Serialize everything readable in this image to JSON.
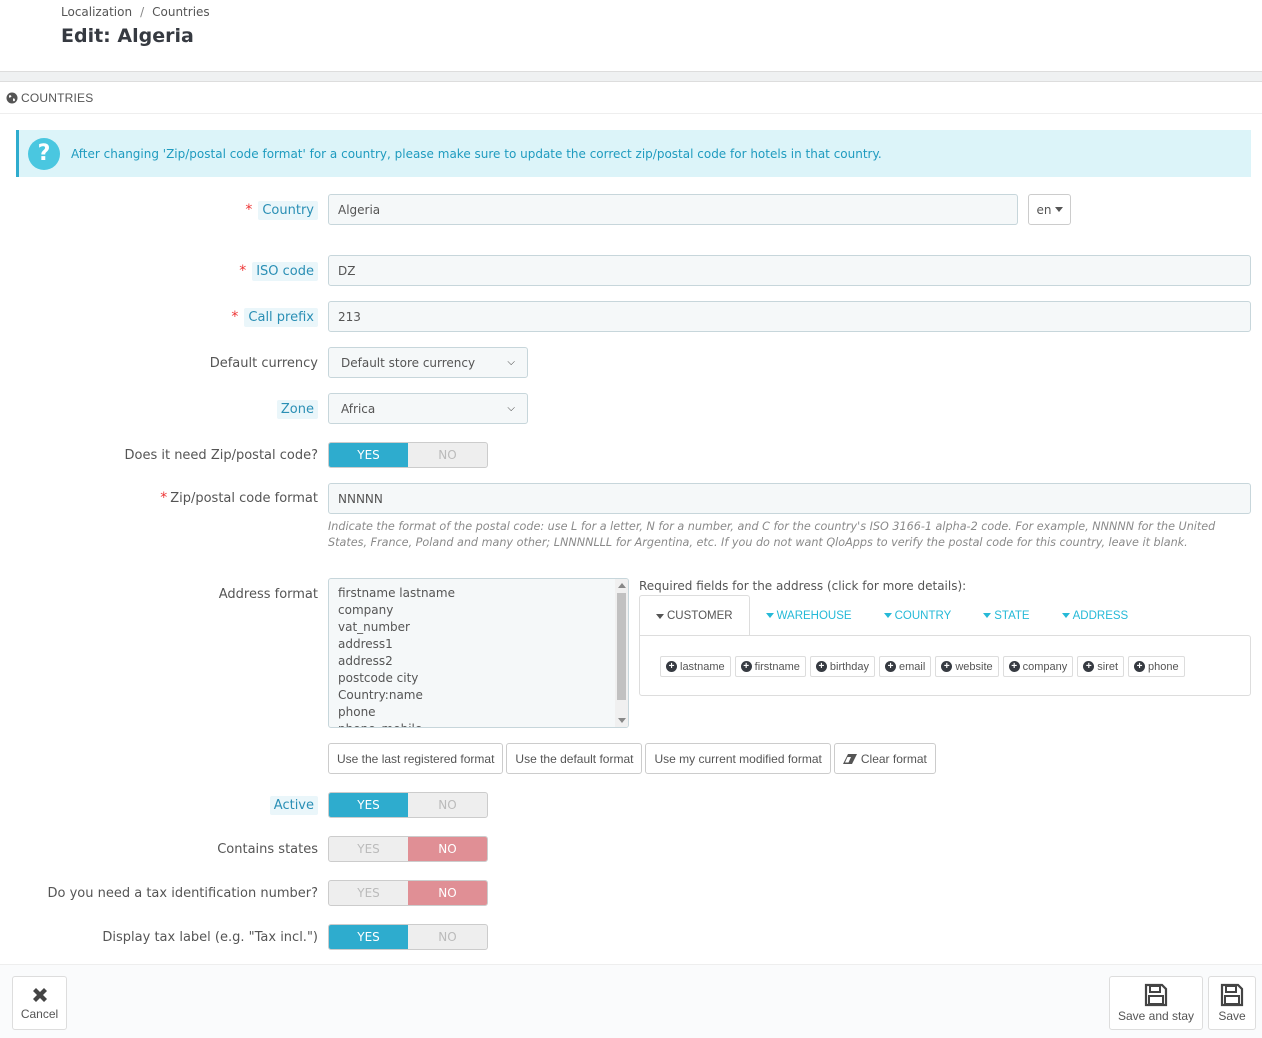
{
  "header": {
    "breadcrumb": [
      "Localization",
      "Countries"
    ],
    "breadcrumb_sep": "/",
    "title": "Edit: Algeria"
  },
  "panel": {
    "icon": "globe-icon",
    "title": "COUNTRIES"
  },
  "alert": {
    "icon": "question-circle-icon",
    "icon_glyph": "?",
    "text": "After changing 'Zip/postal code format' for a country, please make sure to update the correct zip/postal code for hotels in that country."
  },
  "form": {
    "country": {
      "label": "Country",
      "required": "*",
      "value": "Algeria",
      "lang": "en"
    },
    "iso_code": {
      "label": "ISO code",
      "required": "*",
      "value": "DZ"
    },
    "call_prefix": {
      "label": "Call prefix",
      "required": "*",
      "value": "213"
    },
    "default_currency": {
      "label": "Default currency",
      "selected": "Default store currency"
    },
    "zone": {
      "label": "Zone",
      "selected": "Africa"
    },
    "need_zip": {
      "label": "Does it need Zip/postal code?",
      "yes": "YES",
      "no": "NO",
      "value": "YES"
    },
    "zip_format": {
      "label": "Zip/postal code format",
      "required": "*",
      "value": "NNNNN",
      "help": "Indicate the format of the postal code: use L for a letter, N for a number, and C for the country's ISO 3166-1 alpha-2 code. For example, NNNNN for the United States, France, Poland and many other; LNNNNLLL for Argentina, etc. If you do not want QloApps to verify the postal code for this country, leave it blank."
    },
    "address_format": {
      "label": "Address format",
      "lines": [
        "firstname lastname",
        "company",
        "vat_number",
        "address1",
        "address2",
        "postcode city",
        "Country:name",
        "phone",
        "phone_mobile"
      ]
    },
    "required_fields": {
      "title": "Required fields for the address (click for more details):",
      "tabs": [
        "CUSTOMER",
        "WAREHOUSE",
        "COUNTRY",
        "STATE",
        "ADDRESS"
      ],
      "active_tab": "CUSTOMER",
      "fields": [
        "lastname",
        "firstname",
        "birthday",
        "email",
        "website",
        "company",
        "siret",
        "phone"
      ]
    },
    "format_buttons": {
      "last_registered": "Use the last registered format",
      "default": "Use the default format",
      "current_modified": "Use my current modified format",
      "clear": "Clear format"
    },
    "active": {
      "label": "Active",
      "yes": "YES",
      "no": "NO",
      "value": "YES"
    },
    "contains_states": {
      "label": "Contains states",
      "yes": "YES",
      "no": "NO",
      "value": "NO"
    },
    "need_tax_id": {
      "label": "Do you need a tax identification number?",
      "yes": "YES",
      "no": "NO",
      "value": "NO"
    },
    "display_tax_label": {
      "label": "Display tax label (e.g. \"Tax incl.\")",
      "yes": "YES",
      "no": "NO",
      "value": "YES"
    }
  },
  "footer": {
    "cancel": "Cancel",
    "save_and_stay": "Save and stay",
    "save": "Save"
  },
  "colors": {
    "accent": "#2eacce",
    "no_active": "#e08f95",
    "alert_bg": "#dcf4f9",
    "link": "#25b9d7"
  }
}
